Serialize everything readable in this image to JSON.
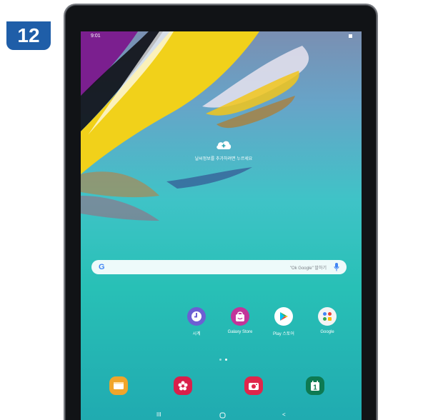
{
  "step": {
    "number": "12"
  },
  "status_bar": {
    "time": "9:01"
  },
  "home_widget": {
    "cloud_label": "날씨정보를 추가하려면 누르세요"
  },
  "search": {
    "google_logo": "G",
    "hint": "\"Ok Google\" 말하기"
  },
  "apps": [
    {
      "label": "시계",
      "icon": "clock-icon",
      "color": "#6c5fd3"
    },
    {
      "label": "Galaxy Store",
      "icon": "store-bag-icon",
      "color": "#c2359a"
    },
    {
      "label": "Play 스토어",
      "icon": "play-store-icon",
      "color": "#ffffff"
    },
    {
      "label": "Google",
      "icon": "google-folder-icon",
      "color": "#f3f4f4"
    }
  ],
  "page_indicator": {
    "count": 2,
    "active_index": 1
  },
  "dock": [
    {
      "icon": "messages-icon",
      "color": "#f0a52a"
    },
    {
      "icon": "gallery-flower-icon",
      "color": "#d91f4b"
    },
    {
      "icon": "camera-icon",
      "color": "#e0264b"
    },
    {
      "icon": "calendar-icon",
      "color": "#0d7a52"
    }
  ],
  "calendar_day": "1",
  "nav": {
    "recents": "III",
    "home": "O",
    "back": "<"
  }
}
